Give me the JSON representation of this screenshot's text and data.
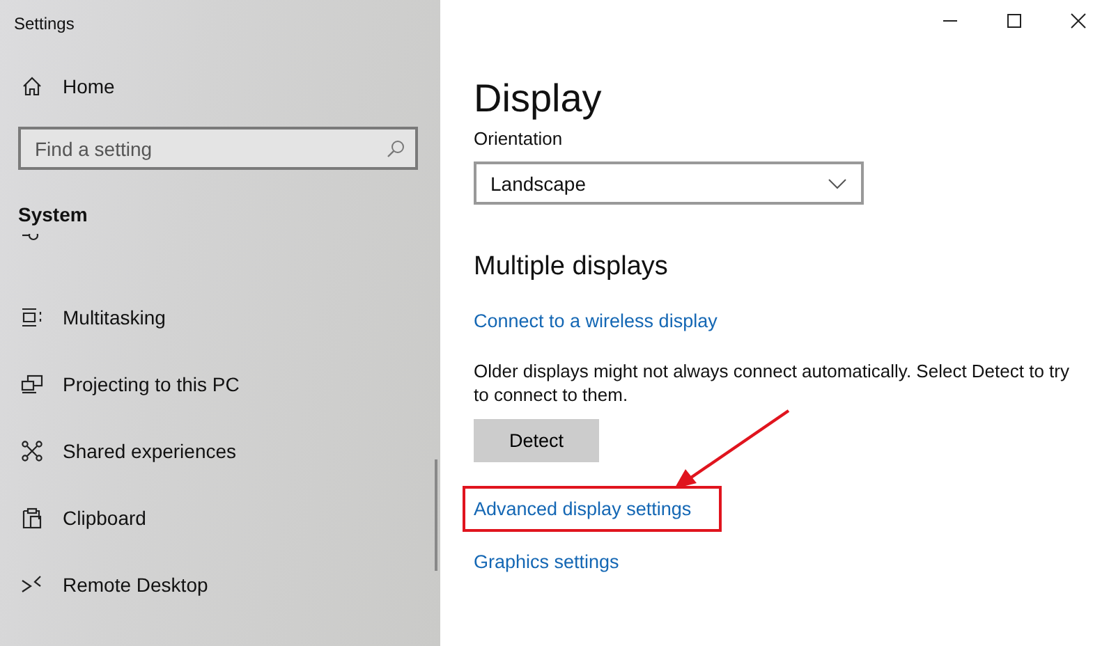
{
  "window": {
    "title": "Settings"
  },
  "sidebar": {
    "home": "Home",
    "search": {
      "placeholder": "Find a setting"
    },
    "section": "System",
    "items": [
      {
        "label": "Multitasking"
      },
      {
        "label": "Projecting to this PC"
      },
      {
        "label": "Shared experiences"
      },
      {
        "label": "Clipboard"
      },
      {
        "label": "Remote Desktop"
      }
    ]
  },
  "page": {
    "title": "Display",
    "orientation": {
      "label": "Orientation",
      "value": "Landscape"
    },
    "multiple_displays": {
      "heading": "Multiple displays",
      "connect_link": "Connect to a wireless display",
      "note": "Older displays might not always connect automatically. Select Detect to try to connect to them.",
      "detect_button": "Detect"
    },
    "links": [
      {
        "label": "Advanced display settings",
        "highlighted": true
      },
      {
        "label": "Graphics settings",
        "highlighted": false
      }
    ]
  }
}
